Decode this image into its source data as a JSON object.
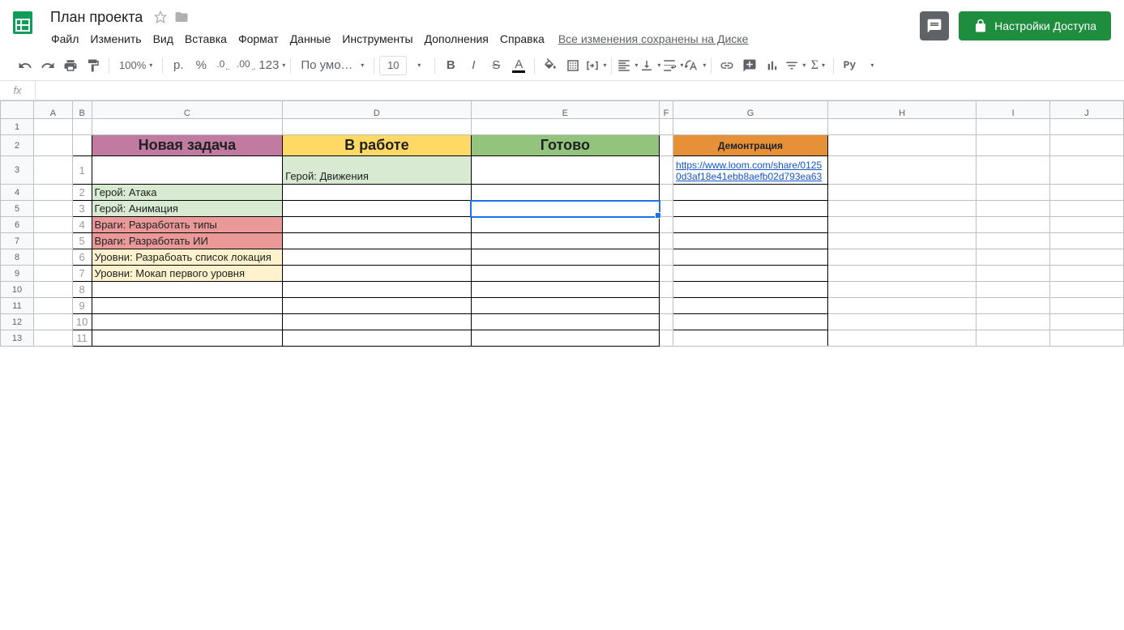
{
  "doc": {
    "title": "План проекта",
    "save_state": "Все изменения сохранены на Диске"
  },
  "menu": {
    "file": "Файл",
    "edit": "Изменить",
    "view": "Вид",
    "insert": "Вставка",
    "format": "Формат",
    "data": "Данные",
    "tools": "Инструменты",
    "addons": "Дополнения",
    "help": "Справка"
  },
  "share": {
    "label": "Настройки Доступа"
  },
  "toolbar": {
    "zoom": "100%",
    "currency": "р.",
    "percent": "%",
    "dec_dec": ".0",
    "dec_inc": ".00",
    "num_fmt": "123",
    "font": "По умолча…",
    "font_size": "10",
    "bold": "B",
    "italic": "I",
    "strike": "S",
    "color": "A",
    "py": "Рy"
  },
  "formula": {
    "fx": "fx",
    "value": ""
  },
  "columns": [
    "",
    "A",
    "B",
    "C",
    "D",
    "E",
    "F",
    "G",
    "H",
    "I",
    "J"
  ],
  "board": {
    "col_new": "Новая задача",
    "col_work": "В работе",
    "col_done": "Готово",
    "col_demo": "Демонтрация",
    "idx": [
      "1",
      "2",
      "3",
      "4",
      "5",
      "6",
      "7",
      "8",
      "9",
      "10",
      "11"
    ],
    "r1_work": "Герой: Движения",
    "r2_new": "Герой: Атака",
    "r3_new": "Герой: Анимация",
    "r4_new": "Враги: Разработать типы",
    "r5_new": "Враги: Разработать ИИ",
    "r6_new": "Уровни: Разрабоать список локация",
    "r7_new": "Уровни: Мокап первого уровня",
    "demo_link": "https://www.loom.com/share/01250d3af18e41ebb8aefb02d793ea63"
  },
  "rows": [
    "1",
    "2",
    "3",
    "4",
    "5",
    "6",
    "7",
    "8",
    "9",
    "10",
    "11",
    "12",
    "13"
  ]
}
